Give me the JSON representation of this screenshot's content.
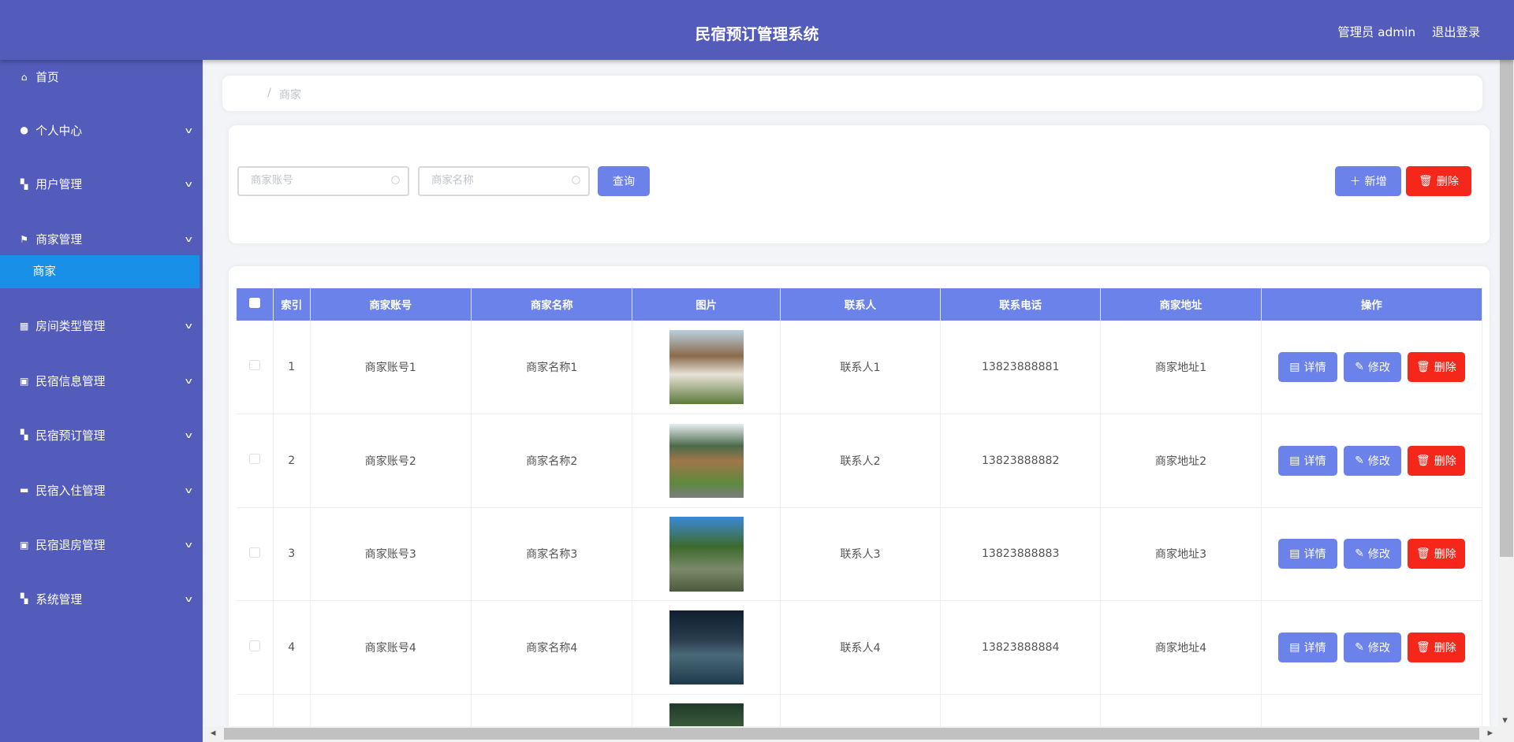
{
  "header": {
    "title": "民宿预订管理系统",
    "user": "管理员 admin",
    "logout": "退出登录"
  },
  "sidebar": {
    "items": [
      {
        "label": "首页",
        "icon": "home-icon",
        "glyph": "⌂",
        "sub": false
      },
      {
        "label": "个人中心",
        "icon": "user-icon",
        "glyph": "●",
        "sub": true
      },
      {
        "label": "用户管理",
        "icon": "grid-icon",
        "glyph": "▚",
        "sub": true
      },
      {
        "label": "商家管理",
        "icon": "flag-icon",
        "glyph": "⚑",
        "sub": true
      },
      {
        "label": "房间类型管理",
        "icon": "grid-icon",
        "glyph": "▦",
        "sub": true
      },
      {
        "label": "民宿信息管理",
        "icon": "clipboard-icon",
        "glyph": "▣",
        "sub": true
      },
      {
        "label": "民宿预订管理",
        "icon": "grid-icon",
        "glyph": "▚",
        "sub": true
      },
      {
        "label": "民宿入住管理",
        "icon": "wallet-icon",
        "glyph": "▬",
        "sub": true
      },
      {
        "label": "民宿退房管理",
        "icon": "clipboard-check-icon",
        "glyph": "▣",
        "sub": true
      },
      {
        "label": "系统管理",
        "icon": "grid-icon",
        "glyph": "▚",
        "sub": true
      }
    ],
    "active_sub": "商家"
  },
  "breadcrumb": {
    "sep": "/",
    "current": "商家"
  },
  "search": {
    "account_placeholder": "商家账号",
    "name_placeholder": "商家名称",
    "query": "查询",
    "add": "新增",
    "delete": "删除"
  },
  "table": {
    "columns": [
      "索引",
      "商家账号",
      "商家名称",
      "图片",
      "联系人",
      "联系电话",
      "商家地址",
      "操作"
    ],
    "rows": [
      {
        "index": "1",
        "account": "商家账号1",
        "name": "商家名称1",
        "contact": "联系人1",
        "phone": "13823888881",
        "address": "商家地址1"
      },
      {
        "index": "2",
        "account": "商家账号2",
        "name": "商家名称2",
        "contact": "联系人2",
        "phone": "13823888882",
        "address": "商家地址2"
      },
      {
        "index": "3",
        "account": "商家账号3",
        "name": "商家名称3",
        "contact": "联系人3",
        "phone": "13823888883",
        "address": "商家地址3"
      },
      {
        "index": "4",
        "account": "商家账号4",
        "name": "商家名称4",
        "contact": "联系人4",
        "phone": "13823888884",
        "address": "商家地址4"
      },
      {
        "index": "",
        "account": "",
        "name": "",
        "contact": "",
        "phone": "",
        "address": ""
      }
    ],
    "actions": {
      "detail": "详情",
      "edit": "修改",
      "delete": "删除"
    }
  },
  "colors": {
    "header": "#535bbb",
    "active": "#1890e8",
    "primary": "#6b82ea",
    "danger": "#f5261a"
  }
}
